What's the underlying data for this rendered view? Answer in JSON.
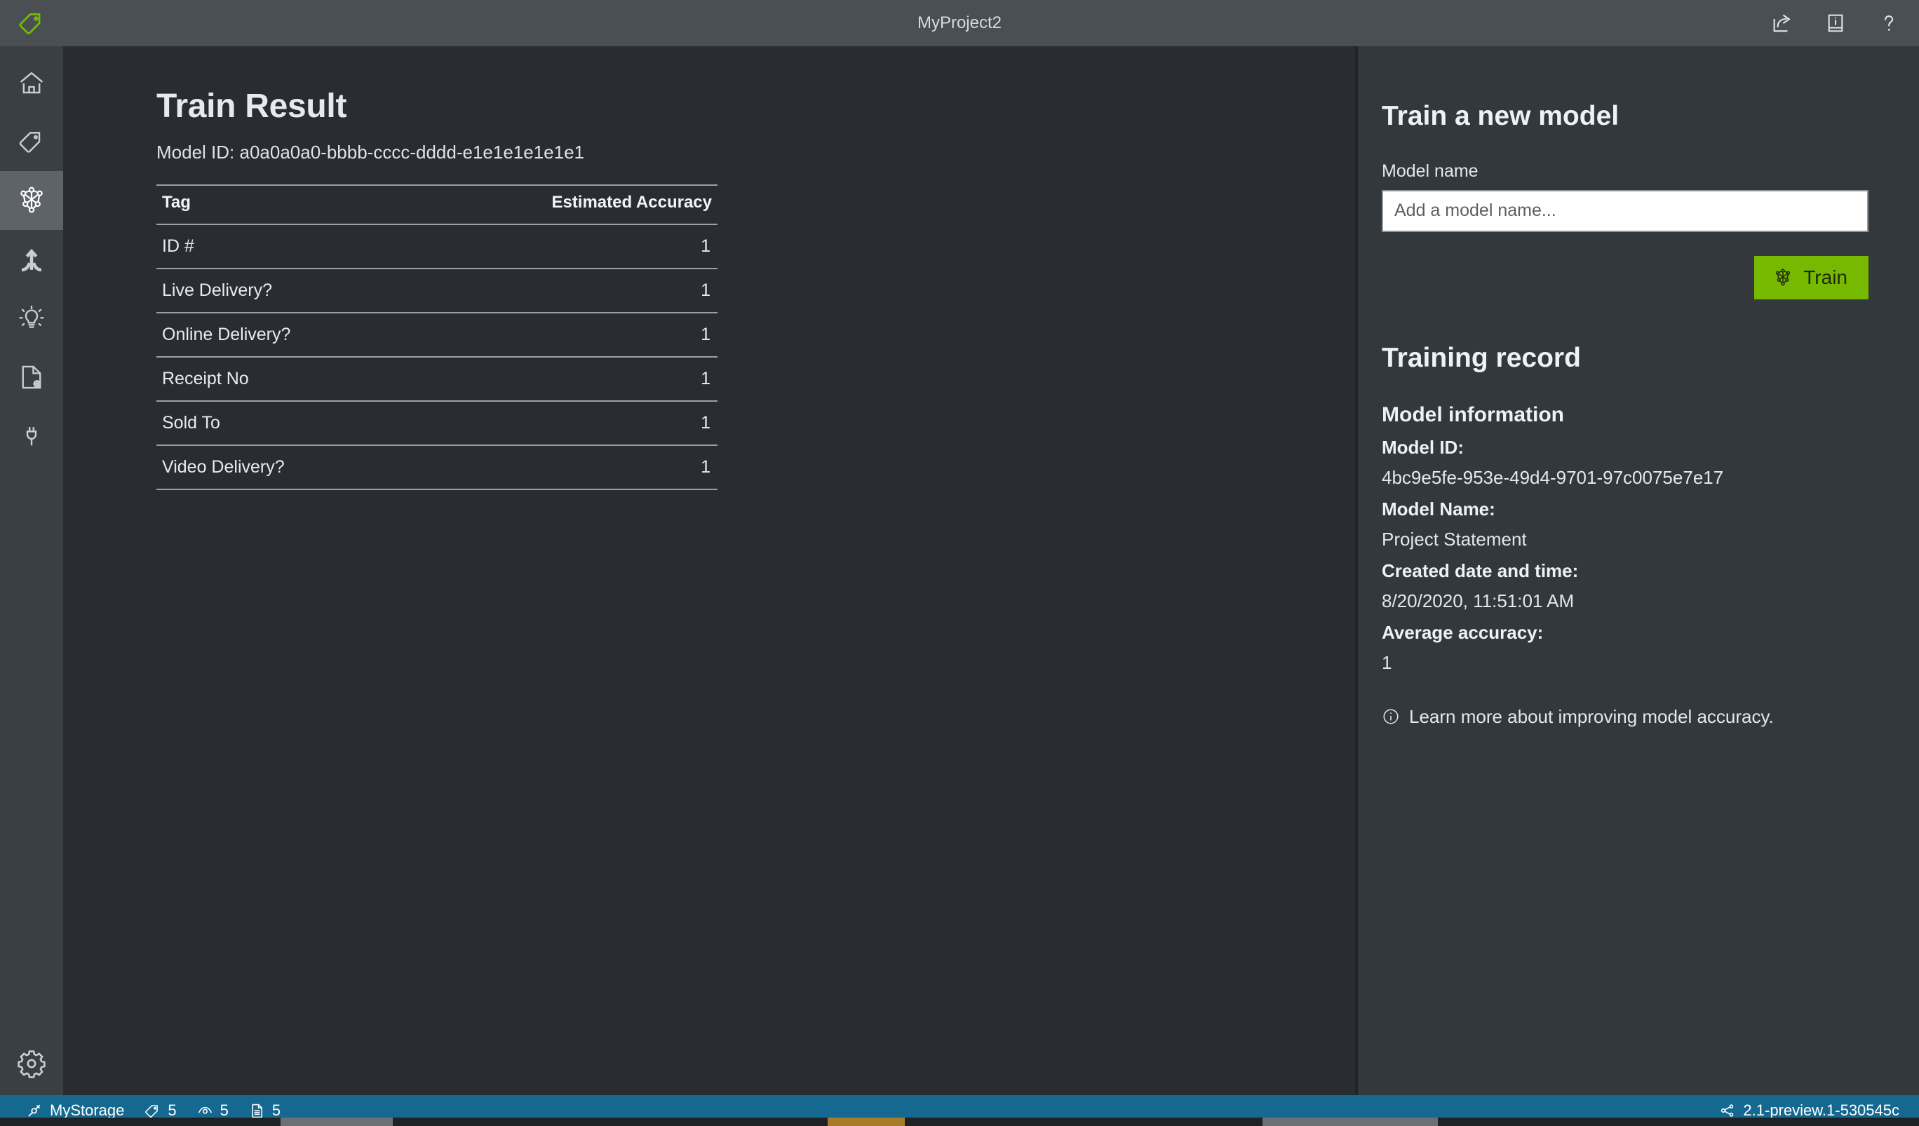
{
  "titlebar": {
    "title": "MyProject2",
    "logo_icon": "tag-logo-icon",
    "actions": [
      {
        "name": "share-icon",
        "label": "Share"
      },
      {
        "name": "info-book-icon",
        "label": "Info"
      },
      {
        "name": "help-icon",
        "label": "Help"
      }
    ]
  },
  "rail": {
    "items": [
      {
        "name": "sidebar-item-home",
        "icon": "home-icon",
        "label": "Home",
        "active": false
      },
      {
        "name": "sidebar-item-tags",
        "icon": "tag-icon",
        "label": "Tags",
        "active": false
      },
      {
        "name": "sidebar-item-model",
        "icon": "model-graph-icon",
        "label": "Model",
        "active": true
      },
      {
        "name": "sidebar-item-predict",
        "icon": "merge-arrow-icon",
        "label": "Predict",
        "active": false
      },
      {
        "name": "sidebar-item-insights",
        "icon": "lightbulb-icon",
        "label": "Insights",
        "active": false
      },
      {
        "name": "sidebar-item-documents",
        "icon": "document-gear-icon",
        "label": "Documents",
        "active": false
      },
      {
        "name": "sidebar-item-connections",
        "icon": "plug-icon",
        "label": "Connections",
        "active": false
      }
    ],
    "bottom": {
      "name": "sidebar-item-settings",
      "icon": "gear-icon",
      "label": "Settings"
    }
  },
  "main": {
    "page_title": "Train Result",
    "model_id_line": "Model ID: a0a0a0a0-bbbb-cccc-dddd-e1e1e1e1e1e1",
    "table": {
      "columns": [
        "Tag",
        "Estimated Accuracy"
      ],
      "rows": [
        {
          "tag": "ID #",
          "accuracy": "1"
        },
        {
          "tag": "Live Delivery?",
          "accuracy": "1"
        },
        {
          "tag": "Online Delivery?",
          "accuracy": "1"
        },
        {
          "tag": "Receipt No",
          "accuracy": "1"
        },
        {
          "tag": "Sold To",
          "accuracy": "1"
        },
        {
          "tag": "Video Delivery?",
          "accuracy": "1"
        }
      ]
    }
  },
  "sidepanel": {
    "train_heading": "Train a new model",
    "model_name_label": "Model name",
    "model_name_value": "",
    "model_name_placeholder": "Add a model name...",
    "train_button_label": "Train",
    "train_button_icon": "model-graph-icon",
    "training_record_heading": "Training record",
    "model_information_heading": "Model information",
    "fields": [
      {
        "label": "Model ID:",
        "value": "4bc9e5fe-953e-49d4-9701-97c0075e7e17"
      },
      {
        "label": "Model Name:",
        "value": "Project Statement"
      },
      {
        "label": "Created date and time:",
        "value": "8/20/2020, 11:51:01 AM"
      },
      {
        "label": "Average accuracy:",
        "value": "1"
      }
    ],
    "note_icon": "info-circle-icon",
    "note_text": "Learn more about improving model accuracy."
  },
  "statusbar": {
    "storage_icon": "plug-icon",
    "storage_label": "MyStorage",
    "counts": [
      {
        "name": "tag-count",
        "icon": "tag-icon",
        "value": "5"
      },
      {
        "name": "region-count",
        "icon": "eye-icon",
        "value": "5"
      },
      {
        "name": "document-count",
        "icon": "document-icon",
        "value": "5"
      }
    ],
    "version_icon": "branch-icon",
    "version": "2.1-preview.1-530545c"
  },
  "colors": {
    "accent_green": "#76b900",
    "status_blue": "#15688f",
    "titlebar": "#4a4f54",
    "rail": "#3a3f44",
    "main_bg": "#292d31",
    "panel_bg": "#33383c"
  }
}
